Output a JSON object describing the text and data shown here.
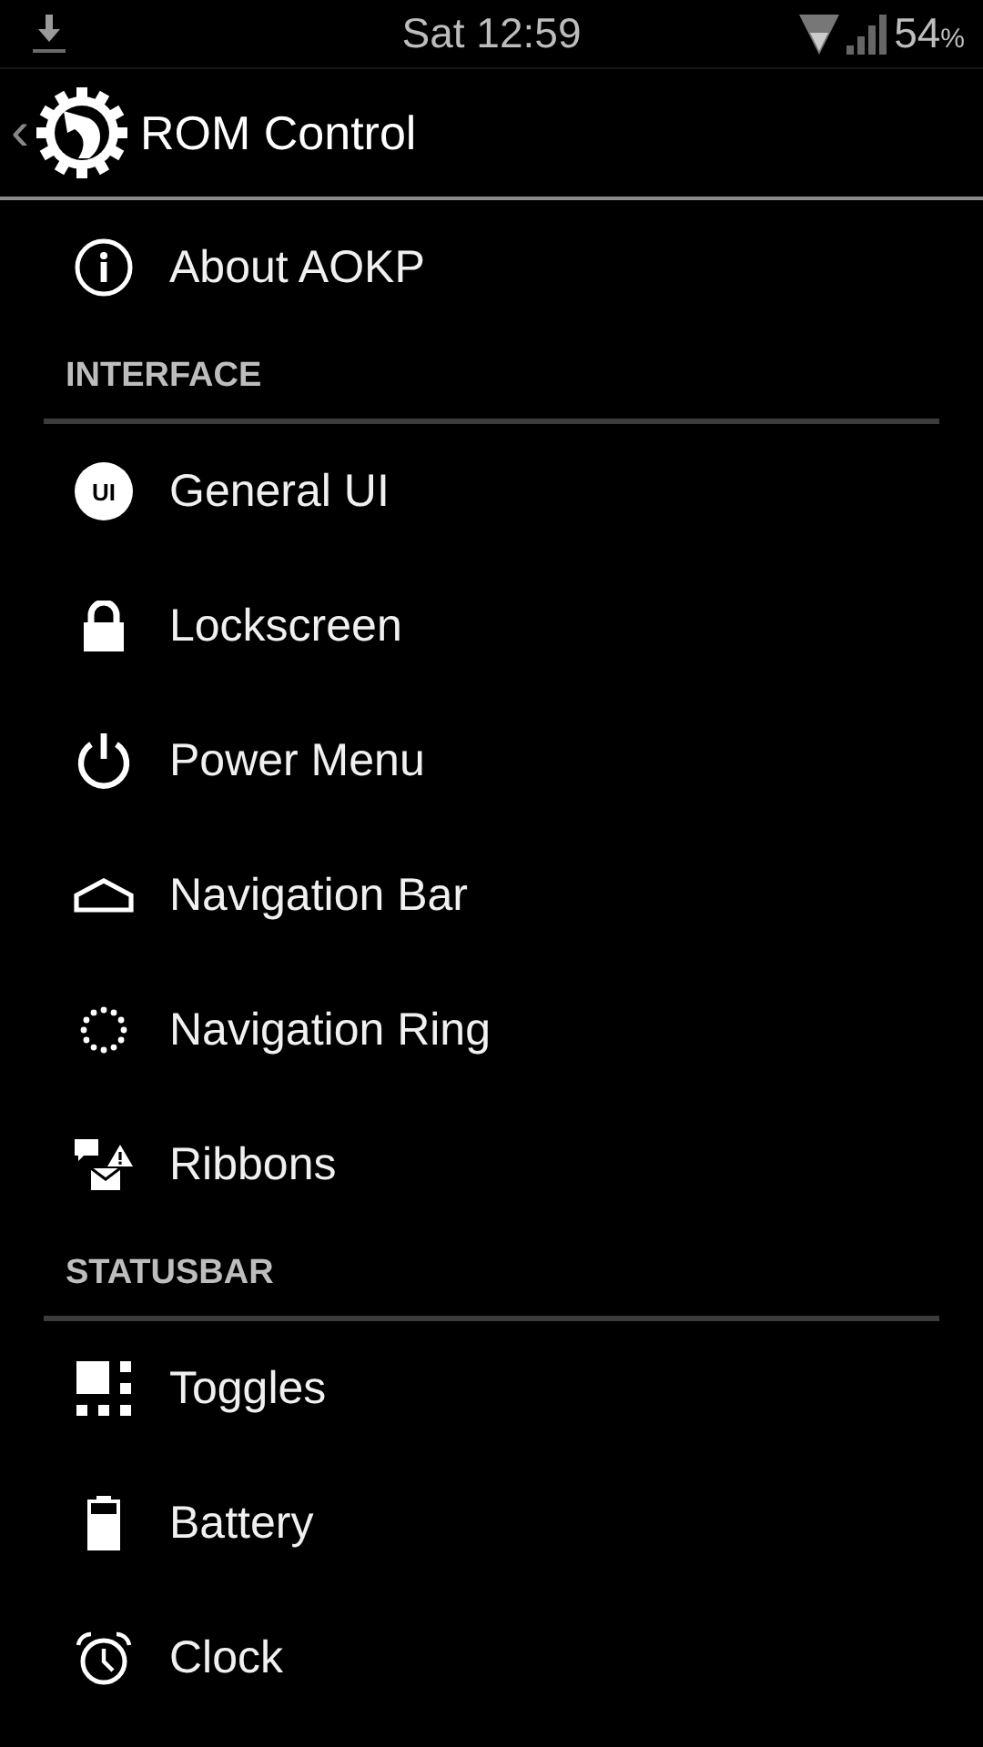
{
  "status_bar": {
    "time": "Sat 12:59",
    "battery": "54",
    "battery_unit": "%"
  },
  "action_bar": {
    "back": "‹",
    "title": "ROM Control"
  },
  "list": [
    {
      "kind": "item",
      "label": "About AOKP"
    },
    {
      "kind": "header",
      "label": "INTERFACE"
    },
    {
      "kind": "item",
      "icon_text": "UI",
      "label": "General UI"
    },
    {
      "kind": "item",
      "label": "Lockscreen"
    },
    {
      "kind": "item",
      "label": "Power Menu"
    },
    {
      "kind": "item",
      "label": "Navigation Bar"
    },
    {
      "kind": "item",
      "label": "Navigation Ring"
    },
    {
      "kind": "item",
      "label": "Ribbons"
    },
    {
      "kind": "header",
      "label": "STATUSBAR"
    },
    {
      "kind": "item",
      "label": "Toggles"
    },
    {
      "kind": "item",
      "label": "Battery"
    },
    {
      "kind": "item",
      "label": "Clock"
    }
  ]
}
